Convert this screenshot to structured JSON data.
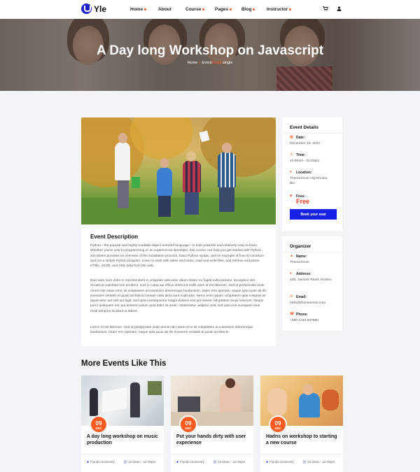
{
  "brand": {
    "name": "Yle"
  },
  "nav": {
    "items": [
      {
        "label": "Home",
        "has_dropdown": true
      },
      {
        "label": "About",
        "has_dropdown": false
      },
      {
        "label": "Course",
        "has_dropdown": true
      },
      {
        "label": "Pages",
        "has_dropdown": true
      },
      {
        "label": "Blog",
        "has_dropdown": true
      },
      {
        "label": "Instructor",
        "has_dropdown": true
      }
    ],
    "icons": [
      "cart-icon",
      "user-icon"
    ]
  },
  "hero": {
    "title": "A Day long Workshop on Javascript",
    "breadcrumb": [
      "Home",
      "Event",
      "Event",
      "single"
    ]
  },
  "event": {
    "description_title": "Event Description",
    "paragraphs": [
      "Python—the popular and highly readable object-oriented language—is both powerful and relatively easy to learn. Whether you're new to programming or an experienced developer, this course can help you get started with Python. Joe Marini provides an overview of the installation process, basic Python syntax, and an example of how to construct and run a simple Python program. Learn to work with dates and times, read and write files, and retrieve and parse HTML, JSON, and XML data from the web.",
      "Duis aute irure dolor in reprehenderit in voluptate velit esse cillum dolore eu fugiat nulla pariatur. Excepteur sint occaecat cupidatat non proident, sunt in culpa qui officia deserunt mollit anim id est laborum. Sed ut perspiciatis unde omnis iste natus error sit voluptatem accusantium doloremque laudantium, totam rem aperiam, eaque ipsa quae ab illo inventore veritatis et quasi architecto beatae vitae dicta sunt explicabo. Nemo enim ipsam voluptatem quia voluptas sit aspernatur aut odit aut fugit, sed quia consequuntur magni dolores eos qui ratione voluptatem sequi nesciunt. Neque porro quisquam est, qui dolorem ipsum quia dolor sit amet, consectetur, adipisci velit, sed quia non numquam eius modi tempora incidunt ut labore.",
      "Lorem id est laborum. Sed ut perspiciatis unde omnis iste natus error sit voluptatem accusantium doloremque laudantium, totam rem aperiam, eaque ipsa quae ab illo inventore veritatis et quasi architecto."
    ]
  },
  "details": {
    "title": "Event Details",
    "date_label": "Date:",
    "date_value": "December 10, 2020",
    "time_label": "Time:",
    "time_value": "10.00am - 02.00pm",
    "location_label": "Location:",
    "location_value": "ThemeXriver HQ Khulna, BD.",
    "fees_label": "Fees:",
    "fees_value": "Free",
    "book_label": "Book your seat"
  },
  "organizer": {
    "title": "Organizer",
    "name_label": "Name:",
    "name_value": "ThemeXriver",
    "address_label": "Address:",
    "address_value": "100, Jassore Raod, Khulna",
    "email_label": "Email:",
    "email_value": "hello@themexriver.com",
    "phone_label": "Phone:",
    "phone_value": "+880 1234 567890"
  },
  "more_events": {
    "title": "More Events Like This",
    "cards": [
      {
        "day": "09",
        "month": "DEC",
        "title": "A day long workshop on music production",
        "location": "Florida University",
        "time": "10.00am - 12.00pm"
      },
      {
        "day": "09",
        "month": "DEC",
        "title": "Put your hands dirty with user experience",
        "location": "Florida University",
        "time": "10.00am - 12.00pm"
      },
      {
        "day": "09",
        "month": "DEC",
        "title": "Hadns on workshop to starting a new course",
        "location": "Florida University",
        "time": "10.00am - 12.00pm"
      }
    ]
  },
  "colors": {
    "accent": "#ff5a1f",
    "primary": "#1720e6",
    "background": "#f3f4f8"
  }
}
